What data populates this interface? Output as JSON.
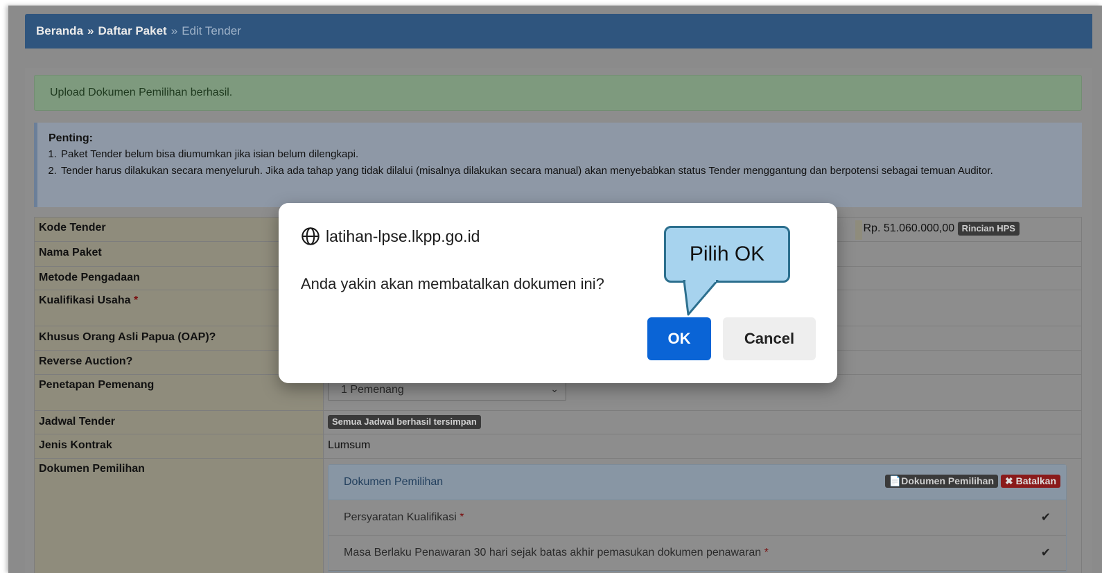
{
  "breadcrumb": {
    "home": "Beranda",
    "sep1": "»",
    "list": "Daftar Paket",
    "sep2": "»",
    "current": "Edit Tender"
  },
  "alerts": {
    "success": "Upload Dokumen Pemilihan berhasil.",
    "info_title": "Penting:",
    "info_items": [
      "Paket Tender belum bisa diumumkan jika isian belum dilengkapi.",
      "Tender harus dilakukan secara menyeluruh. Jika ada tahap yang tidak dilalui (misalnya dilakukan secara manual) akan menyebabkan status Tender menggantung dan berpotensi sebagai temuan Auditor."
    ]
  },
  "form": {
    "kode_tender": "Kode Tender",
    "hps_value": "Rp. 51.060.000,00",
    "rincian_hps": "Rincian HPS",
    "nama_paket": "Nama Paket",
    "metode": "Metode Pengadaan",
    "kualifikasi": "Kualifikasi Usaha",
    "oap": "Khusus Orang Asli Papua (OAP)?",
    "reverse": "Reverse Auction?",
    "penetapan": "Penetapan Pemenang",
    "penetapan_value": "1 Pemenang",
    "jadwal": "Jadwal Tender",
    "jadwal_badge": "Semua Jadwal berhasil tersimpan",
    "jenis_kontrak": "Jenis Kontrak",
    "jenis_kontrak_value": "Lumsum",
    "dokumen": "Dokumen Pemilihan",
    "required_mark": "*"
  },
  "panel": {
    "title": "Dokumen Pemilihan",
    "doc_button": "Dokumen Pemilihan",
    "batal_button": "Batalkan",
    "rows": [
      "Persyaratan Kualifikasi",
      "Masa Berlaku Penawaran 30 hari sejak batas akhir pemasukan dokumen penawaran"
    ]
  },
  "dialog": {
    "origin": "latihan-lpse.lkpp.go.id",
    "message": "Anda yakin akan membatalkan dokumen ini?",
    "ok": "OK",
    "cancel": "Cancel"
  },
  "callout": {
    "text": "Pilih OK"
  },
  "colors": {
    "header": "#2f557e",
    "ok_button": "#0a64d6",
    "callout_fill": "#a7d3ee",
    "callout_border": "#2c6f8e"
  }
}
